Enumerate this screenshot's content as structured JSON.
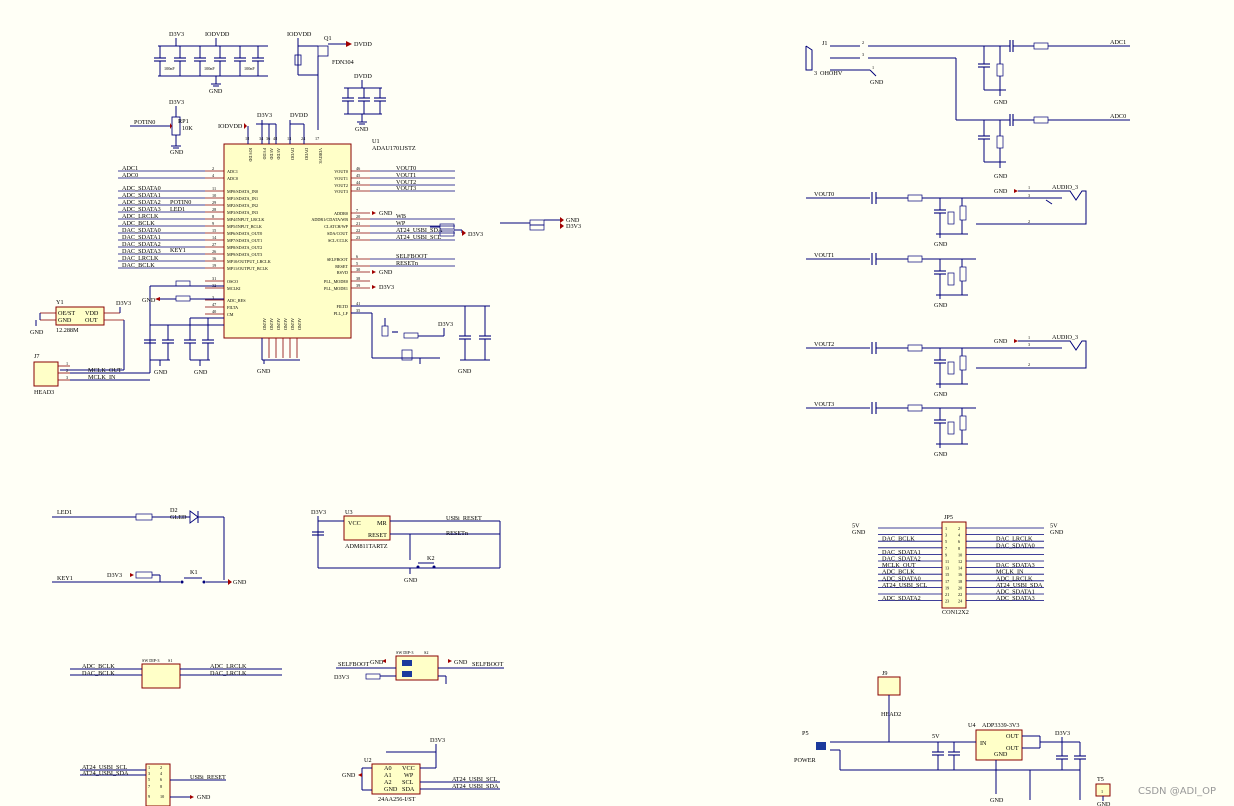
{
  "watermark": "CSDN @ADI_OP",
  "power_rails": {
    "d3v3": "D3V3",
    "iodvdd": "IODVDD",
    "dvdd": "DVDD",
    "gnd": "GND",
    "v5": "5V",
    "v5_alt": "5V",
    "iodvdd_in": "IODVDD"
  },
  "u1": {
    "ref": "U1",
    "part": "ADAU1701JSTZ",
    "left_pins": [
      {
        "num": "2",
        "name": "ADC1",
        "net": "ADC1"
      },
      {
        "num": "4",
        "name": "ADC0",
        "net": "ADC0"
      },
      {
        "num": "11",
        "name": "MP0/SDATA_IN0",
        "net": "ADC_SDATA0"
      },
      {
        "num": "10",
        "name": "MP1/SDATA_IN1",
        "net": "ADC_SDATA1"
      },
      {
        "num": "29",
        "name": "MP2/SDATA_IN2",
        "net": "ADC_SDATA2"
      },
      {
        "num": "28",
        "name": "MP3/SDATA_IN3",
        "net": "ADC_SDATA3"
      },
      {
        "num": "8",
        "name": "MP4/INPUT_LRCLK",
        "net": "ADC_LRCLK"
      },
      {
        "num": "9",
        "name": "MP5/INPUT_BCLK",
        "net": "ADC_BCLK"
      },
      {
        "num": "15",
        "name": "MP6/SDATA_OUT0",
        "net": "DAC_SDATA0"
      },
      {
        "num": "14",
        "name": "MP7/SDATA_OUT1",
        "net": "DAC_SDATA1"
      },
      {
        "num": "27",
        "name": "MP8/SDATA_OUT2",
        "net": "DAC_SDATA2"
      },
      {
        "num": "26",
        "name": "MP9/SDATA_OUT3",
        "net": "DAC_SDATA3"
      },
      {
        "num": "16",
        "name": "MP10/OUTPUT_LRCLK",
        "net": "DAC_LRCLK"
      },
      {
        "num": "19",
        "name": "MP11/OUTPUT_BCLK",
        "net": "DAC_BCLK"
      },
      {
        "num": "31",
        "name": "OSCO",
        "net": ""
      },
      {
        "num": "32",
        "name": "MCLKI",
        "net": ""
      },
      {
        "num": "3",
        "name": "ADC_RES",
        "net": ""
      },
      {
        "num": "47",
        "name": "FILTA",
        "net": ""
      },
      {
        "num": "40",
        "name": "CM",
        "net": ""
      }
    ],
    "right_pins": [
      {
        "num": "46",
        "name": "VOUT0",
        "net": "VOUT0"
      },
      {
        "num": "45",
        "name": "VOUT1",
        "net": "VOUT1"
      },
      {
        "num": "44",
        "name": "VOUT2",
        "net": "VOUT2"
      },
      {
        "num": "43",
        "name": "VOUT3",
        "net": "VOUT3"
      },
      {
        "num": "7",
        "name": "ADDR0",
        "net": "GND"
      },
      {
        "num": "20",
        "name": "ADDR1/CDATA/WB",
        "net": "WB"
      },
      {
        "num": "21",
        "name": "CLATCH/WP",
        "net": "WP"
      },
      {
        "num": "22",
        "name": "SDA/COUT",
        "net": "AT24_USBI_SDA"
      },
      {
        "num": "23",
        "name": "SCL/CCLK",
        "net": "AT24_USBI_SCL"
      },
      {
        "num": "6",
        "name": "SELFBOOT",
        "net": "SELFBOOT"
      },
      {
        "num": "5",
        "name": "RESET",
        "net": "RESETn"
      },
      {
        "num": "30",
        "name": "RSVD",
        "net": "GND"
      },
      {
        "num": "38",
        "name": "PLL_MODE0",
        "net": ""
      },
      {
        "num": "39",
        "name": "PLL_MODE1",
        "net": "D3V3"
      },
      {
        "num": "41",
        "name": "FILTD",
        "net": ""
      },
      {
        "num": "35",
        "name": "PLL_LF",
        "net": ""
      }
    ],
    "top_pins": [
      {
        "num": "18",
        "name": "IOVDD"
      },
      {
        "num": "34",
        "name": "PVDD"
      },
      {
        "num": "36",
        "name": "AVDD"
      },
      {
        "num": "48",
        "name": "AVDD"
      },
      {
        "num": "13",
        "name": "DVDD"
      },
      {
        "num": "24",
        "name": "DVDD"
      },
      {
        "num": "17",
        "name": "VDRIVE"
      }
    ],
    "bottom_pin_names": [
      "AGND",
      "AGND",
      "AGND",
      "AGND",
      "AGND",
      "AGND"
    ]
  },
  "left_nets": {
    "potin": "POTIN0",
    "potin2": "POTIN0",
    "led": "LED1",
    "key": "KEY1",
    "mclk_out": "MCLK_OUT",
    "mclk_in": "MCLK_IN"
  },
  "parts": {
    "rp1": "RP1",
    "rp1_val": "10K",
    "q1": "Q1",
    "q1_part": "FDN304",
    "y1": "Y1",
    "y1_freq": "12.288M",
    "y1_pins": [
      "OE/ST",
      "GND",
      "VDD",
      "OUT"
    ],
    "j7": "J7",
    "j7_part": "HEAD3",
    "j1": "J1",
    "j1_part": "OHOHV",
    "j1_num": "1",
    "j1_hidden": "3",
    "audio3": "AUDIO_3",
    "d2": "D2",
    "d2_part": "GLED",
    "k1": "K1",
    "k2": "K2",
    "u3": "U3",
    "u3_part": "ADM811TARTZ",
    "u3_pins": [
      "VCC",
      "MR",
      "RESET"
    ],
    "jp5": "JP5",
    "jp5_part": "CON12X2",
    "u2": "U2",
    "u2_part": "24AA256-I/ST",
    "u2_pins_left": [
      "A0",
      "A1",
      "A2",
      "GND"
    ],
    "u2_pins_right": [
      "VCC",
      "WP",
      "SCL",
      "SDA"
    ],
    "j9": "J9",
    "j9_part": "HEAD2",
    "u4": "U4",
    "u4_part": "ADP3339-3V3",
    "u4_pins": [
      "IN",
      "OUT",
      "OUT",
      "GND"
    ],
    "p5": "P5",
    "p5_part": "POWER",
    "t5": "T5",
    "usbi_reset": "USBi_RESET",
    "resetn": "RESETn",
    "selfboot": "SELFBOOT",
    "sw1": "SW DIP-3",
    "sw2": "SW DIP-3",
    "s1": "S1",
    "s2": "S2"
  },
  "vout_nets": [
    "VOUT0",
    "VOUT1",
    "VOUT2",
    "VOUT3"
  ],
  "adc_nets": [
    "ADC1",
    "ADC0"
  ],
  "jp5_rows": [
    {
      "l": "5V",
      "pl": "1",
      "pr": "2",
      "r": "5V"
    },
    {
      "l": "GND",
      "pl": "3",
      "pr": "4",
      "r": "GND"
    },
    {
      "l": "DAC_BCLK",
      "pl": "5",
      "pr": "6",
      "r": "DAC_LRCLK"
    },
    {
      "l": "",
      "pl": "7",
      "pr": "8",
      "r": "DAC_SDATA0"
    },
    {
      "l": "DAC_SDATA1",
      "pl": "9",
      "pr": "10",
      "r": ""
    },
    {
      "l": "DAC_SDATA2",
      "pl": "11",
      "pr": "12",
      "r": ""
    },
    {
      "l": "MCLK_OUT",
      "pl": "13",
      "pr": "14",
      "r": "DAC_SDATA3"
    },
    {
      "l": "ADC_BCLK",
      "pl": "15",
      "pr": "16",
      "r": "MCLK_IN"
    },
    {
      "l": "ADC_SDATA0",
      "pl": "17",
      "pr": "18",
      "r": "ADC_LRCLK"
    },
    {
      "l": "AT24_USBI_SCL",
      "pl": "19",
      "pr": "20",
      "r": "AT24_USBI_SDA"
    },
    {
      "l": "",
      "pl": "21",
      "pr": "22",
      "r": "ADC_SDATA1"
    },
    {
      "l": "ADC_SDATA2",
      "pl": "23",
      "pr": "24",
      "r": "ADC_SDATA3"
    }
  ],
  "switch_nets": {
    "adc_bclk": "ADC_BCLK",
    "dac_bclk": "DAC_BCLK",
    "adc_lrclk": "ADC_LRCLK",
    "dac_lrclk": "DAC_LRCLK",
    "at24_scl": "AT24_USBI_SCL",
    "at24_sda": "AT24_USBI_SDA",
    "usbi_reset": "USBi_RESET"
  },
  "i2c_labels": {
    "sda": "AT24_USBI_SDA",
    "scl": "AT24_USBI_SCL",
    "wb": "WB",
    "wp": "WP"
  },
  "cap_labels": {
    "c": "C",
    "r": "R",
    "val_small": "100nF",
    "val_big": "10uF"
  }
}
